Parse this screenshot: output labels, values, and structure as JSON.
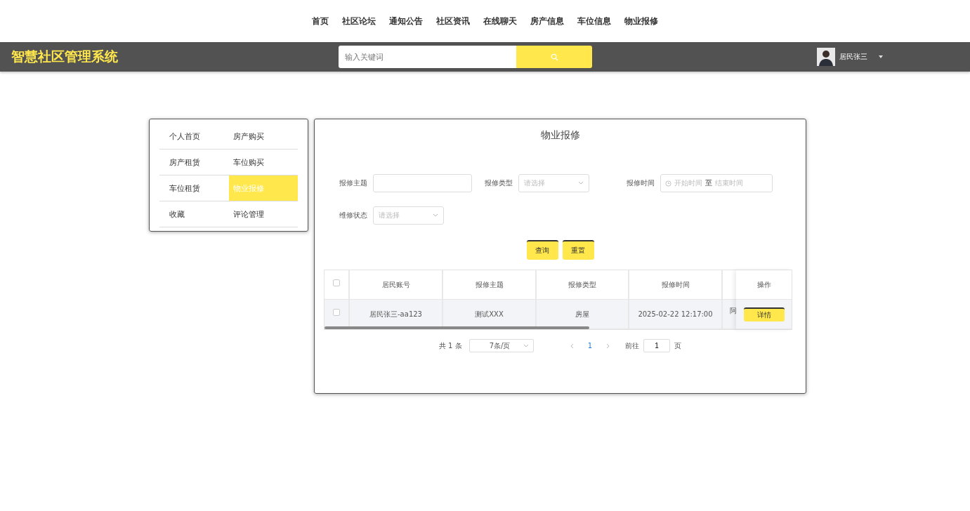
{
  "nav": [
    {
      "label": "首页"
    },
    {
      "label": "社区论坛"
    },
    {
      "label": "通知公告"
    },
    {
      "label": "社区资讯"
    },
    {
      "label": "在线聊天"
    },
    {
      "label": "房产信息"
    },
    {
      "label": "车位信息"
    },
    {
      "label": "物业报修"
    }
  ],
  "header": {
    "logo": "智慧社区管理系统",
    "search": {
      "placeholder": "输入关键词"
    },
    "user": "居民张三"
  },
  "sidebar": {
    "items": [
      {
        "label": "个人首页",
        "selected": false
      },
      {
        "label": "房产购买",
        "selected": false
      },
      {
        "label": "房产租赁",
        "selected": false
      },
      {
        "label": "车位购买",
        "selected": false
      },
      {
        "label": "车位租赁",
        "selected": false
      },
      {
        "label": "物业报修",
        "selected": true
      },
      {
        "label": "收藏",
        "selected": false
      },
      {
        "label": "评论管理",
        "selected": false
      }
    ]
  },
  "panel": {
    "title": "物业报修",
    "filters": [
      {
        "kind": "text",
        "label": "报修主题"
      },
      {
        "kind": "select",
        "label": "报修类型",
        "placeholder": "请选择"
      },
      {
        "kind": "daterange",
        "label": "报修时间",
        "start": "开始时间",
        "sep": "至",
        "end": "结束时间"
      },
      {
        "kind": "select",
        "label": "维修状态",
        "placeholder": "请选择"
      }
    ],
    "buttons": [
      "查询",
      "重置"
    ],
    "table": {
      "columns": [
        "居民账号",
        "报修主题",
        "报修类型",
        "报修时间",
        "操作"
      ],
      "rows": [
        {
          "checked": false,
          "cells": [
            "居民张三-aa123",
            "测试XXX",
            "房屋",
            "2025-02-22 12:17:00"
          ],
          "column_6": "阿",
          "action": "详情"
        }
      ],
      "header_checked": false
    },
    "pagination": {
      "total": "共 1 条",
      "page_size": "7条/页",
      "current": "1",
      "goto_label": "前往",
      "goto_value": "1",
      "page_unit": "页"
    }
  }
}
